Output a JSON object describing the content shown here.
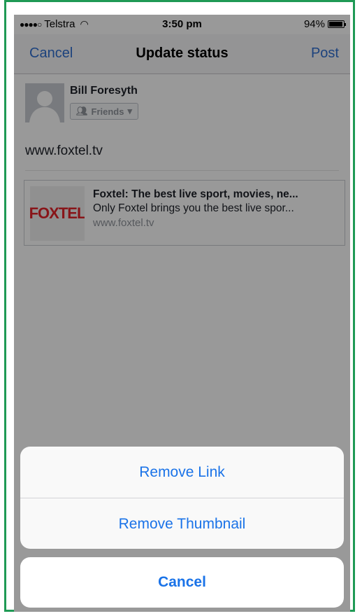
{
  "status_bar": {
    "signal": "●●●●○",
    "carrier": "Telstra",
    "wifi_icon": "wifi-icon",
    "time": "3:50 pm",
    "battery_percent": "94%",
    "battery_level": 0.94
  },
  "nav": {
    "cancel_label": "Cancel",
    "title": "Update status",
    "post_label": "Post"
  },
  "composer": {
    "user_name": "Bill Foresyth",
    "audience_label": "Friends",
    "status_text": "www.foxtel.tv"
  },
  "link_preview": {
    "thumbnail_text": "FOXTEL",
    "title": "Foxtel: The best live sport, movies, ne...",
    "description": "Only Foxtel brings you the best live spor...",
    "domain": "www.foxtel.tv"
  },
  "action_sheet": {
    "options": [
      "Remove Link",
      "Remove Thumbnail"
    ],
    "cancel_label": "Cancel"
  },
  "colors": {
    "accent_blue": "#1a73e8",
    "nav_blue": "#2f6fd1",
    "frame_green": "#1f9a55"
  }
}
